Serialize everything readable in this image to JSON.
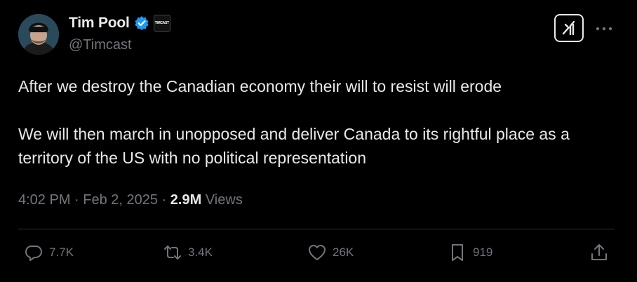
{
  "author": {
    "name": "Tim Pool",
    "handle": "@Timcast",
    "affiliate_badge_text": "TIMCAST"
  },
  "tweet": {
    "text": "After we destroy the Canadian economy their will to resist will erode\n\nWe will then march in unopposed and  deliver Canada to its rightful place as a territory of the US with no political representation",
    "time": "4:02 PM",
    "date": "Feb 2, 2025",
    "views_count": "2.9M",
    "views_label": "Views"
  },
  "actions": {
    "replies": "7.7K",
    "reposts": "3.4K",
    "likes": "26K",
    "bookmarks": "919"
  },
  "colors": {
    "background": "#000000",
    "text": "#e7e9ea",
    "muted": "#71767b",
    "verified": "#1d9bf0",
    "divider": "#2f3336"
  },
  "icons": [
    "verified-badge-icon",
    "grok-icon",
    "more-icon",
    "reply-icon",
    "repost-icon",
    "like-icon",
    "bookmark-icon",
    "share-icon"
  ]
}
